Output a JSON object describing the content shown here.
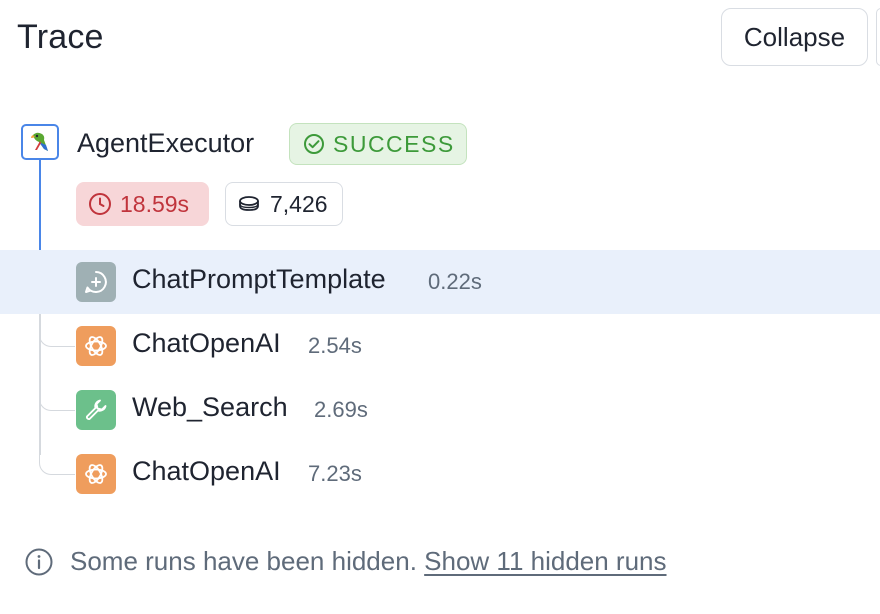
{
  "header": {
    "title": "Trace",
    "collapse_label": "Collapse"
  },
  "root": {
    "name": "AgentExecutor",
    "icon": "parrot-icon",
    "status": "SUCCESS",
    "latency": "18.59s",
    "tokens": "7,426"
  },
  "runs": [
    {
      "name": "ChatPromptTemplate",
      "time": "0.22s",
      "icon": "chat-prompt-icon",
      "color": "#9fb0b4",
      "selected": true
    },
    {
      "name": "ChatOpenAI",
      "time": "2.54s",
      "icon": "openai-icon",
      "color": "#ef9d5d",
      "selected": false
    },
    {
      "name": "Web_Search",
      "time": "2.69s",
      "icon": "wrench-icon",
      "color": "#6cc08b",
      "selected": false
    },
    {
      "name": "ChatOpenAI",
      "time": "7.23s",
      "icon": "openai-icon",
      "color": "#ef9d5d",
      "selected": false
    }
  ],
  "footer": {
    "message": "Some runs have been hidden.",
    "link": "Show 11 hidden runs"
  },
  "colors": {
    "accent": "#4a86e8",
    "success": "#3d9a3a",
    "error": "#c0343c",
    "selected_row": "#e9f0fb"
  }
}
